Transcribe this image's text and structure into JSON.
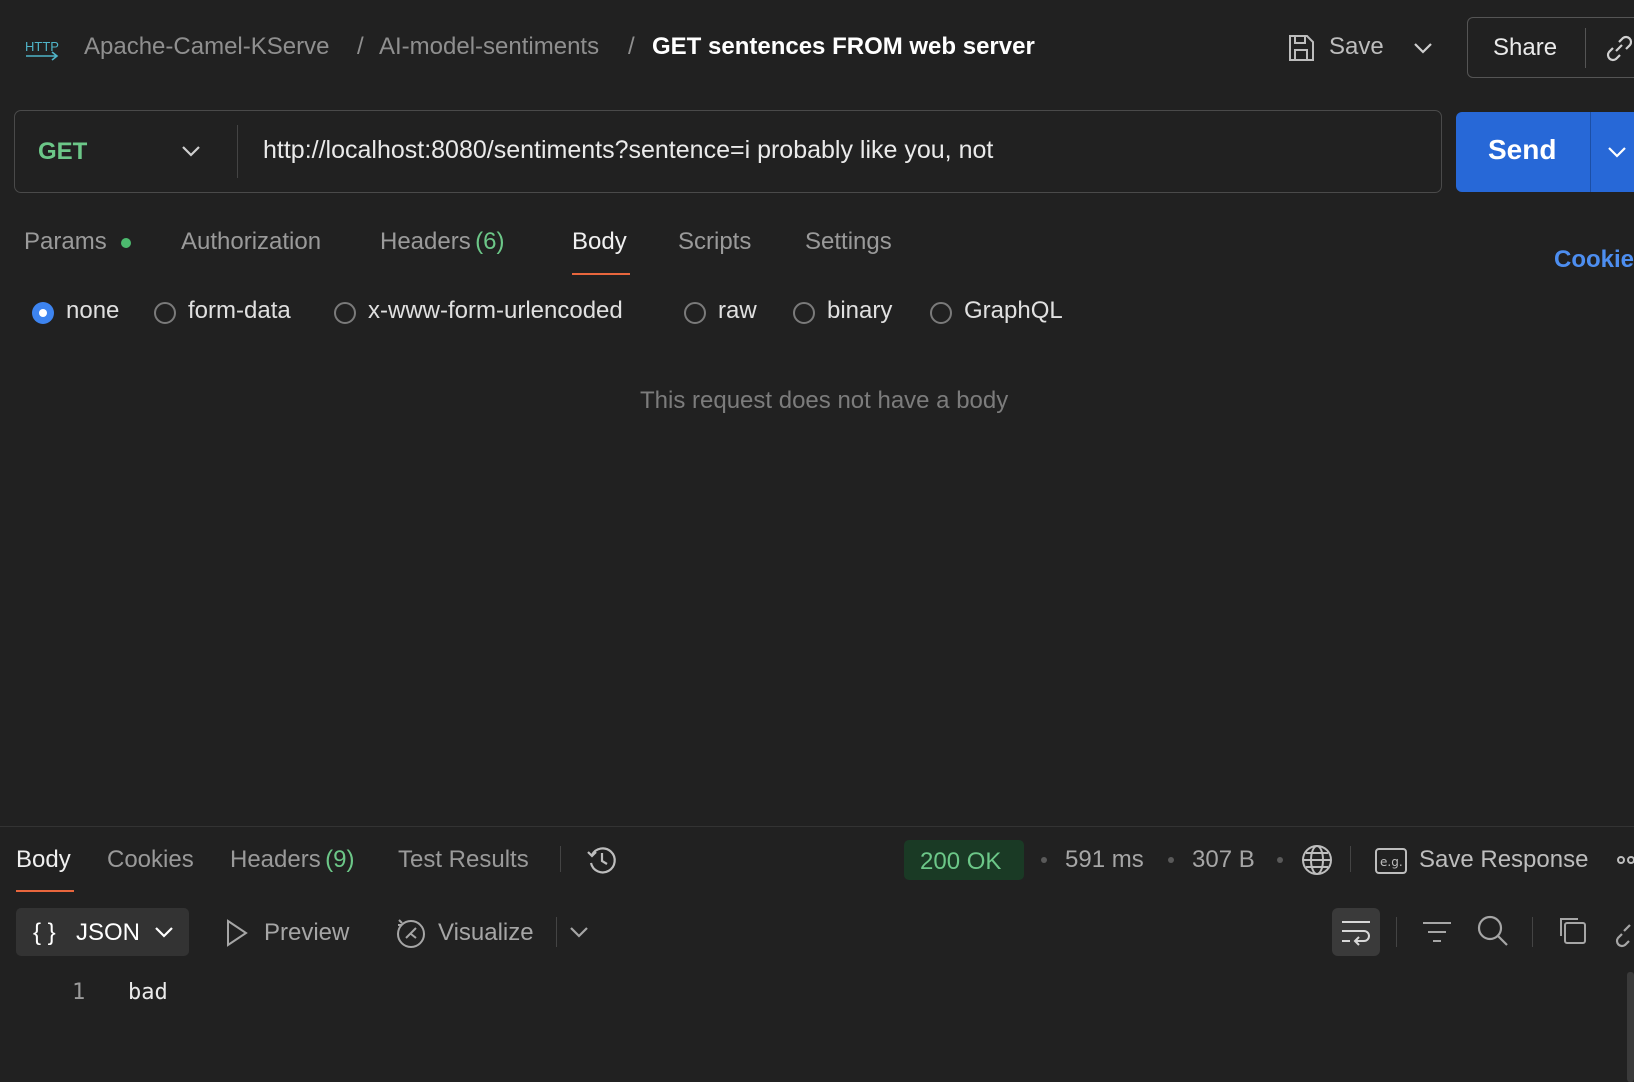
{
  "header": {
    "http_badge": "HTTP",
    "breadcrumb": [
      "Apache-Camel-KServe",
      "AI-model-sentiments"
    ],
    "separator": "/",
    "request_name": "GET sentences FROM web server",
    "save_label": "Save",
    "share_label": "Share"
  },
  "request": {
    "method": "GET",
    "url": "http://localhost:8080/sentiments?sentence=i probably like you, not",
    "send_label": "Send"
  },
  "request_tabs": {
    "params": "Params",
    "authorization": "Authorization",
    "headers": "Headers",
    "headers_count": "(6)",
    "body": "Body",
    "scripts": "Scripts",
    "settings": "Settings",
    "cookies": "Cookies"
  },
  "body_types": {
    "options": [
      "none",
      "form-data",
      "x-www-form-urlencoded",
      "raw",
      "binary",
      "GraphQL"
    ],
    "selected": "none",
    "empty_message": "This request does not have a body"
  },
  "response": {
    "tabs": {
      "body": "Body",
      "cookies": "Cookies",
      "headers": "Headers",
      "headers_count": "(9)",
      "test_results": "Test Results"
    },
    "status": "200 OK",
    "time": "591 ms",
    "size": "307 B",
    "save_response": "Save Response",
    "format": "JSON",
    "preview": "Preview",
    "visualize": "Visualize",
    "lines": [
      {
        "number": "1",
        "text": "bad"
      }
    ]
  },
  "colors": {
    "background": "#212121",
    "accent_send": "#2768d7",
    "success": "#6cc788",
    "tab_underline": "#e8663d",
    "link": "#4d8ef0"
  }
}
